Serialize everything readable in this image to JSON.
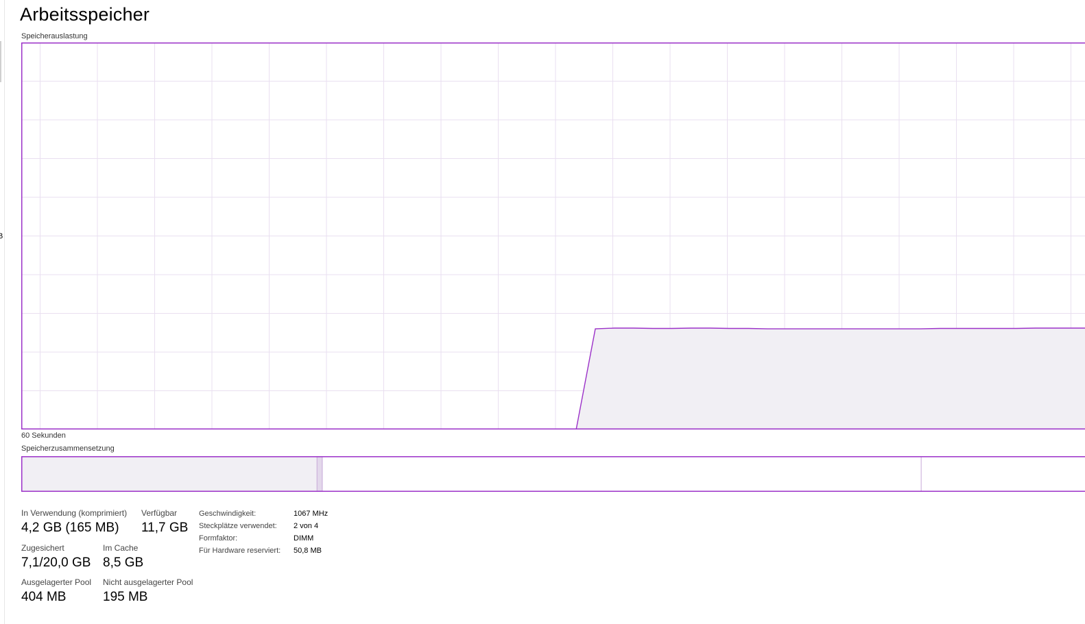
{
  "header": {
    "title": "Arbeitsspeicher"
  },
  "left_edge_glyph": "B",
  "usage_graph": {
    "label": "Speicherauslastung",
    "time_label": "60 Sekunden",
    "line_color": "#9b30c8",
    "fill_color": "#f1eff4",
    "grid_color": "#e9dff0",
    "usage_fraction_series": [
      0,
      0,
      0,
      0,
      0,
      0,
      0,
      0,
      0,
      0,
      0,
      0,
      0,
      0,
      0,
      0,
      0,
      0,
      0,
      0,
      0,
      0,
      0,
      0,
      0,
      0,
      0,
      0,
      0,
      0,
      0.26,
      0.262,
      0.262,
      0.261,
      0.261,
      0.262,
      0.262,
      0.261,
      0.261,
      0.26,
      0.26,
      0.26,
      0.26,
      0.26,
      0.26,
      0.26,
      0.26,
      0.26,
      0.261,
      0.261,
      0.261,
      0.261,
      0.261,
      0.262,
      0.262,
      0.262,
      0.262,
      0.262,
      0.261,
      0.261
    ]
  },
  "composition": {
    "label": "Speicherzusammensetzung",
    "segments": [
      {
        "name": "in-use",
        "fraction": 0.278,
        "fill": "#f1eff4"
      },
      {
        "name": "modified",
        "fraction": 0.005,
        "fill": "#e3d8eb"
      },
      {
        "name": "standby",
        "fraction": 0.563,
        "fill": "#ffffff"
      },
      {
        "name": "free",
        "fraction": 0.154,
        "fill": "#ffffff"
      }
    ]
  },
  "stats": {
    "in_use": {
      "label": "In Verwendung (komprimiert)",
      "value": "4,2 GB (165 MB)"
    },
    "available": {
      "label": "Verfügbar",
      "value": "11,7 GB"
    },
    "committed": {
      "label": "Zugesichert",
      "value": "7,1/20,0 GB"
    },
    "cached": {
      "label": "Im Cache",
      "value": "8,5 GB"
    },
    "paged_pool": {
      "label": "Ausgelagerter Pool",
      "value": "404 MB"
    },
    "nonpaged_pool": {
      "label": "Nicht ausgelagerter Pool",
      "value": "195 MB"
    }
  },
  "info": [
    {
      "key": "Geschwindigkeit:",
      "value": "1067 MHz"
    },
    {
      "key": "Steckplätze verwendet:",
      "value": "2 von 4"
    },
    {
      "key": "Formfaktor:",
      "value": "DIMM"
    },
    {
      "key": "Für Hardware reserviert:",
      "value": "50,8 MB"
    }
  ]
}
